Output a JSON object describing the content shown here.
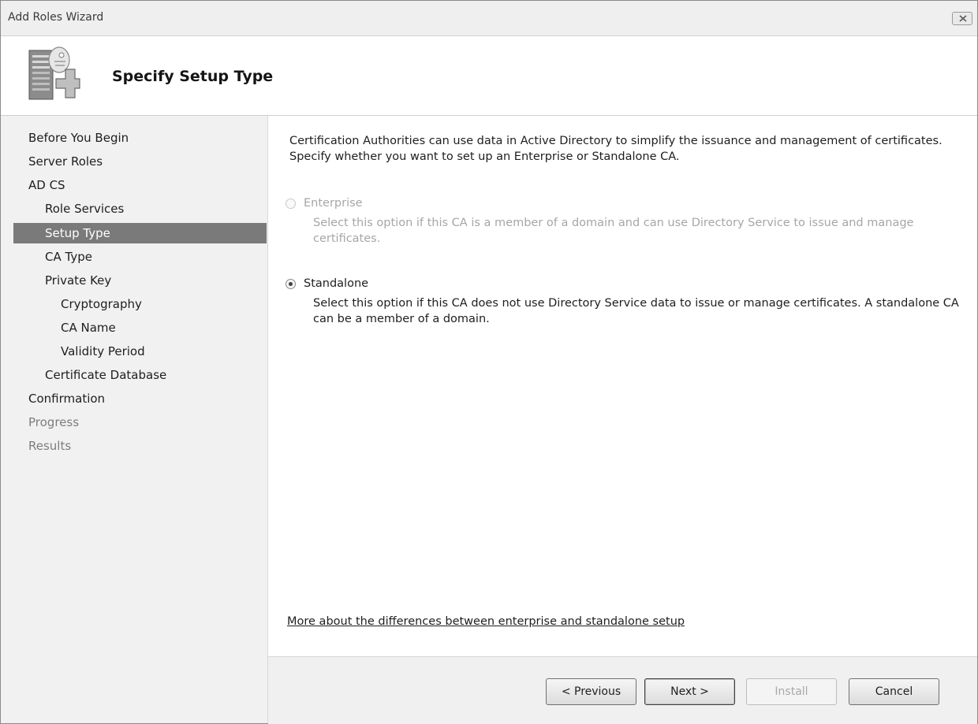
{
  "window": {
    "title": "Add Roles Wizard",
    "close_icon": "close-icon"
  },
  "header": {
    "heading": "Specify Setup Type",
    "icon": "server-roles-icon"
  },
  "nav": {
    "items": [
      {
        "label": "Before You Begin",
        "state": "normal"
      },
      {
        "label": "Server Roles",
        "state": "normal"
      },
      {
        "label": "AD CS",
        "state": "normal"
      },
      {
        "label": "Role Services",
        "state": "normal"
      },
      {
        "label": "Setup Type",
        "state": "selected"
      },
      {
        "label": "CA Type",
        "state": "normal"
      },
      {
        "label": "Private Key",
        "state": "normal"
      },
      {
        "label": "Cryptography",
        "state": "normal"
      },
      {
        "label": "CA Name",
        "state": "normal"
      },
      {
        "label": "Validity Period",
        "state": "normal"
      },
      {
        "label": "Certificate Database",
        "state": "normal"
      },
      {
        "label": "Confirmation",
        "state": "normal"
      },
      {
        "label": "Progress",
        "state": "disabled"
      },
      {
        "label": "Results",
        "state": "disabled"
      }
    ]
  },
  "content": {
    "intro": "Certification Authorities can use data in Active Directory to simplify the issuance and management of certificates. Specify whether you want to set up an Enterprise or Standalone CA.",
    "options": [
      {
        "label": "Enterprise",
        "description": "Select this option if this CA is a member of a domain and can use Directory Service to issue and manage certificates.",
        "selected": false,
        "enabled": false
      },
      {
        "label": "Standalone",
        "description": "Select this option if this CA does not use Directory Service data to issue or manage certificates. A standalone CA can be a member of a domain.",
        "selected": true,
        "enabled": true
      }
    ],
    "more_link": "More about the differences between enterprise and standalone setup"
  },
  "footer": {
    "previous": "< Previous",
    "next": "Next >",
    "install": "Install",
    "cancel": "Cancel"
  }
}
